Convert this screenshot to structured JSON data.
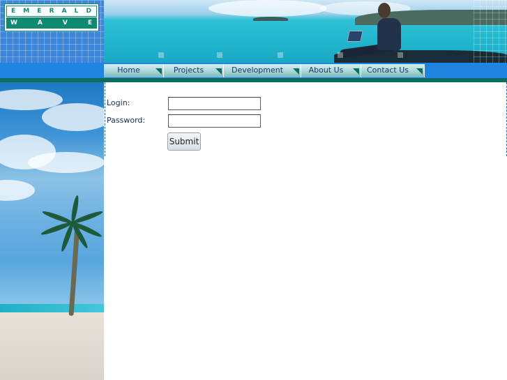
{
  "logo": {
    "line1": "EMERALD",
    "line2": "WAVE"
  },
  "nav": {
    "tabs": [
      {
        "label": "Home"
      },
      {
        "label": "Projects"
      },
      {
        "label": "Development"
      },
      {
        "label": "About Us"
      },
      {
        "label": "Contact Us"
      }
    ]
  },
  "login_form": {
    "login_label": "Login:",
    "login_value": "",
    "password_label": "Password:",
    "password_value": "",
    "submit_label": "Submit"
  },
  "colors": {
    "nav_bar": "#1f85e0",
    "nav_accent": "#0c6d5e",
    "logo_green": "#0f8a72",
    "tab_text": "#173a63"
  },
  "icons": {
    "nav_tab_arrow": "triangle-corner-icon"
  }
}
